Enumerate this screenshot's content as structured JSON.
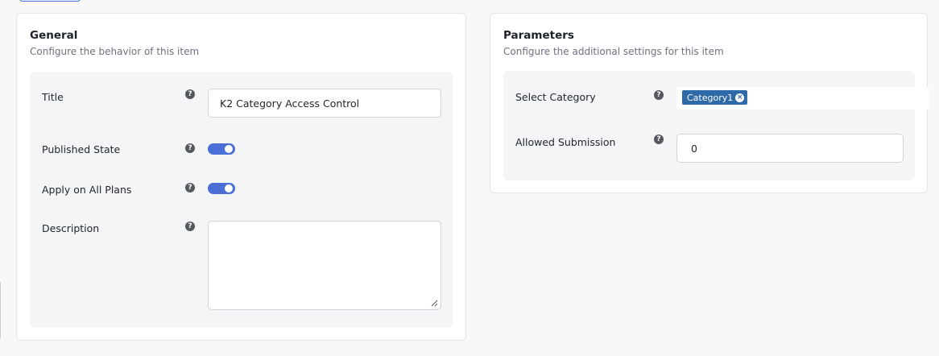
{
  "general": {
    "title": "General",
    "subtitle": "Configure the behavior of this item",
    "fields": {
      "title_label": "Title",
      "title_value": "K2 Category Access Control",
      "published_label": "Published State",
      "published_on": true,
      "apply_all_label": "Apply on All Plans",
      "apply_all_on": true,
      "description_label": "Description",
      "description_value": ""
    }
  },
  "parameters": {
    "title": "Parameters",
    "subtitle": "Configure the additional settings for this item",
    "fields": {
      "select_category_label": "Select Category",
      "selected_categories": [
        "Category1"
      ],
      "allowed_submission_label": "Allowed Submission",
      "allowed_submission_value": "0"
    }
  },
  "icons": {
    "help": "question-circle-icon",
    "chip_remove": "close-circle-icon",
    "resize": "resize-grip-icon"
  },
  "colors": {
    "accent": "#4a6fd6",
    "chip": "#2f6aa8"
  }
}
